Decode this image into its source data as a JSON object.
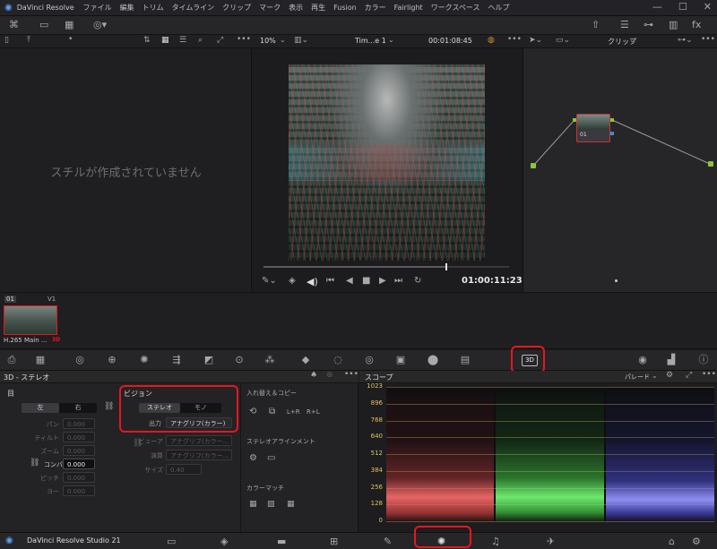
{
  "titlebar": {
    "app_name": "DaVinci Resolve",
    "menus": [
      "ファイル",
      "編集",
      "トリム",
      "タイムライン",
      "クリップ",
      "マーク",
      "表示",
      "再生",
      "Fusion",
      "カラー",
      "Fairlight",
      "ワークスペース",
      "ヘルプ"
    ],
    "window_controls": [
      "minimize-icon",
      "maximize-icon",
      "close-icon"
    ]
  },
  "viewer_toolbar": {
    "zoom": "10%",
    "timeline_name": "Tim...e 1",
    "timecode": "00:01:08:45",
    "clip_mode": "クリップ"
  },
  "gallery": {
    "empty_message": "スチルが作成されていません"
  },
  "viewer": {
    "timecode": "01:00:11:23",
    "scrub_progress": 0.74
  },
  "nodes": {
    "node_label": "01"
  },
  "clip_strip": {
    "clip_number": "01",
    "track": "V1",
    "clip_name": "H.265 Main ...",
    "badge": "3D"
  },
  "stereo_panel": {
    "title": "3D - ステレオ",
    "eye_section": "目",
    "left_tab": "左",
    "right_tab": "右",
    "params": [
      {
        "label": "パン",
        "value": "0.000"
      },
      {
        "label": "ティルト",
        "value": "0.000"
      },
      {
        "label": "ズーム",
        "value": "0.000"
      },
      {
        "label": "コンバ",
        "value": "0.000"
      },
      {
        "label": "ピッチ",
        "value": "0.000"
      },
      {
        "label": "ヨー",
        "value": "0.000"
      }
    ],
    "vision": {
      "title": "ビジョン",
      "stereo_tab": "ステレオ",
      "mono_tab": "モノ",
      "output_label": "出力",
      "output_value": "アナグリフ(カラー)",
      "viewer_label": "ビューア",
      "viewer_value": "アナグリフ(カラー...",
      "render_label": "演算",
      "render_value": "アナグリフ(カラー...",
      "size_label": "サイズ",
      "size_value": "0.40"
    },
    "swap": {
      "title": "入れ替え＆コピー",
      "lr": "L+R",
      "rl": "R+L"
    },
    "alignment_title": "ステレオアラインメント",
    "color_match_title": "カラーマッチ"
  },
  "scope_panel": {
    "title": "スコープ",
    "mode": "パレード",
    "ticks": [
      "1023",
      "896",
      "768",
      "640",
      "512",
      "384",
      "256",
      "128",
      "0"
    ],
    "colors": {
      "red": "#ff4a4a",
      "green": "#38e038",
      "blue": "#4a4aff"
    }
  },
  "footer": {
    "brand": "DaVinci Resolve Studio 21",
    "active_page": "color"
  },
  "accent": {
    "highlight": "#e8161e",
    "timecode": "#e8e8e8"
  }
}
